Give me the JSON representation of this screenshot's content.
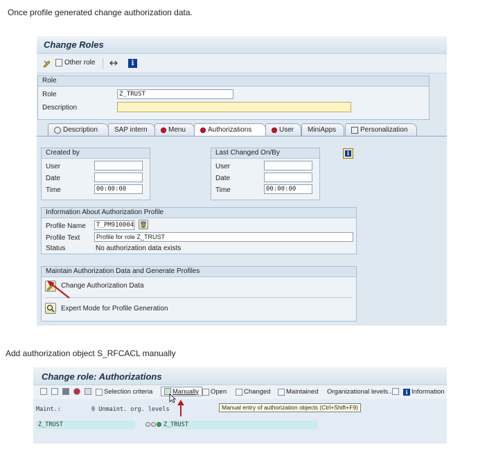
{
  "caption1": "Once profile generated change authorization data.",
  "caption2": "Add authorization object S_RFCACL manually",
  "screen1": {
    "title": "Change Roles",
    "toolbar": {
      "other_role": "Other role"
    },
    "role_box": {
      "header": "Role",
      "role_label": "Role",
      "role_value": "Z_TRUST",
      "description_label": "Description",
      "description_value": ""
    },
    "tabs": [
      {
        "label": "Description",
        "icon": "doc-icon"
      },
      {
        "label": "SAP intern",
        "icon": ""
      },
      {
        "label": "Menu",
        "icon": "red-status-icon"
      },
      {
        "label": "Authorizations",
        "icon": "red-status-icon"
      },
      {
        "label": "User",
        "icon": "red-status-icon"
      },
      {
        "label": "MiniApps",
        "icon": ""
      },
      {
        "label": "Personalization",
        "icon": "personalization-icon"
      }
    ],
    "created_by": {
      "header": "Created by",
      "user_label": "User",
      "user_value": "",
      "date_label": "Date",
      "date_value": "",
      "time_label": "Time",
      "time_value": "00:00:00"
    },
    "last_changed": {
      "header": "Last Changed On/By",
      "user_label": "User",
      "user_value": "",
      "date_label": "Date",
      "date_value": "",
      "time_label": "Time",
      "time_value": "00:00:00"
    },
    "profile_info": {
      "header": "Information About Authorization Profile",
      "name_label": "Profile Name",
      "name_value": "T_PM910004",
      "text_label": "Profile Text",
      "text_value": "Profile for role Z_TRUST",
      "status_label": "Status",
      "status_value": "No authorization data exists"
    },
    "maintain": {
      "header": "Maintain Authorization Data and Generate Profiles",
      "change_label": "Change Authorization Data",
      "expert_label": "Expert Mode for Profile Generation"
    }
  },
  "screen2": {
    "title": "Change role: Authorizations",
    "toolbar": {
      "selection_criteria": "Selection criteria",
      "manually": "Manually",
      "open": "Open",
      "changed": "Changed",
      "maintained": "Maintained",
      "org_levels": "Organizational levels...",
      "information": "Information"
    },
    "tooltip": "Manual entry of authorization objects   (Ctrl+Shift+F9)",
    "maint_label": "Maint.:",
    "unmaint_text": "0  Unmaint. org. levels",
    "row_left": "Z_TRUST",
    "row_right": "Z_TRUST"
  }
}
